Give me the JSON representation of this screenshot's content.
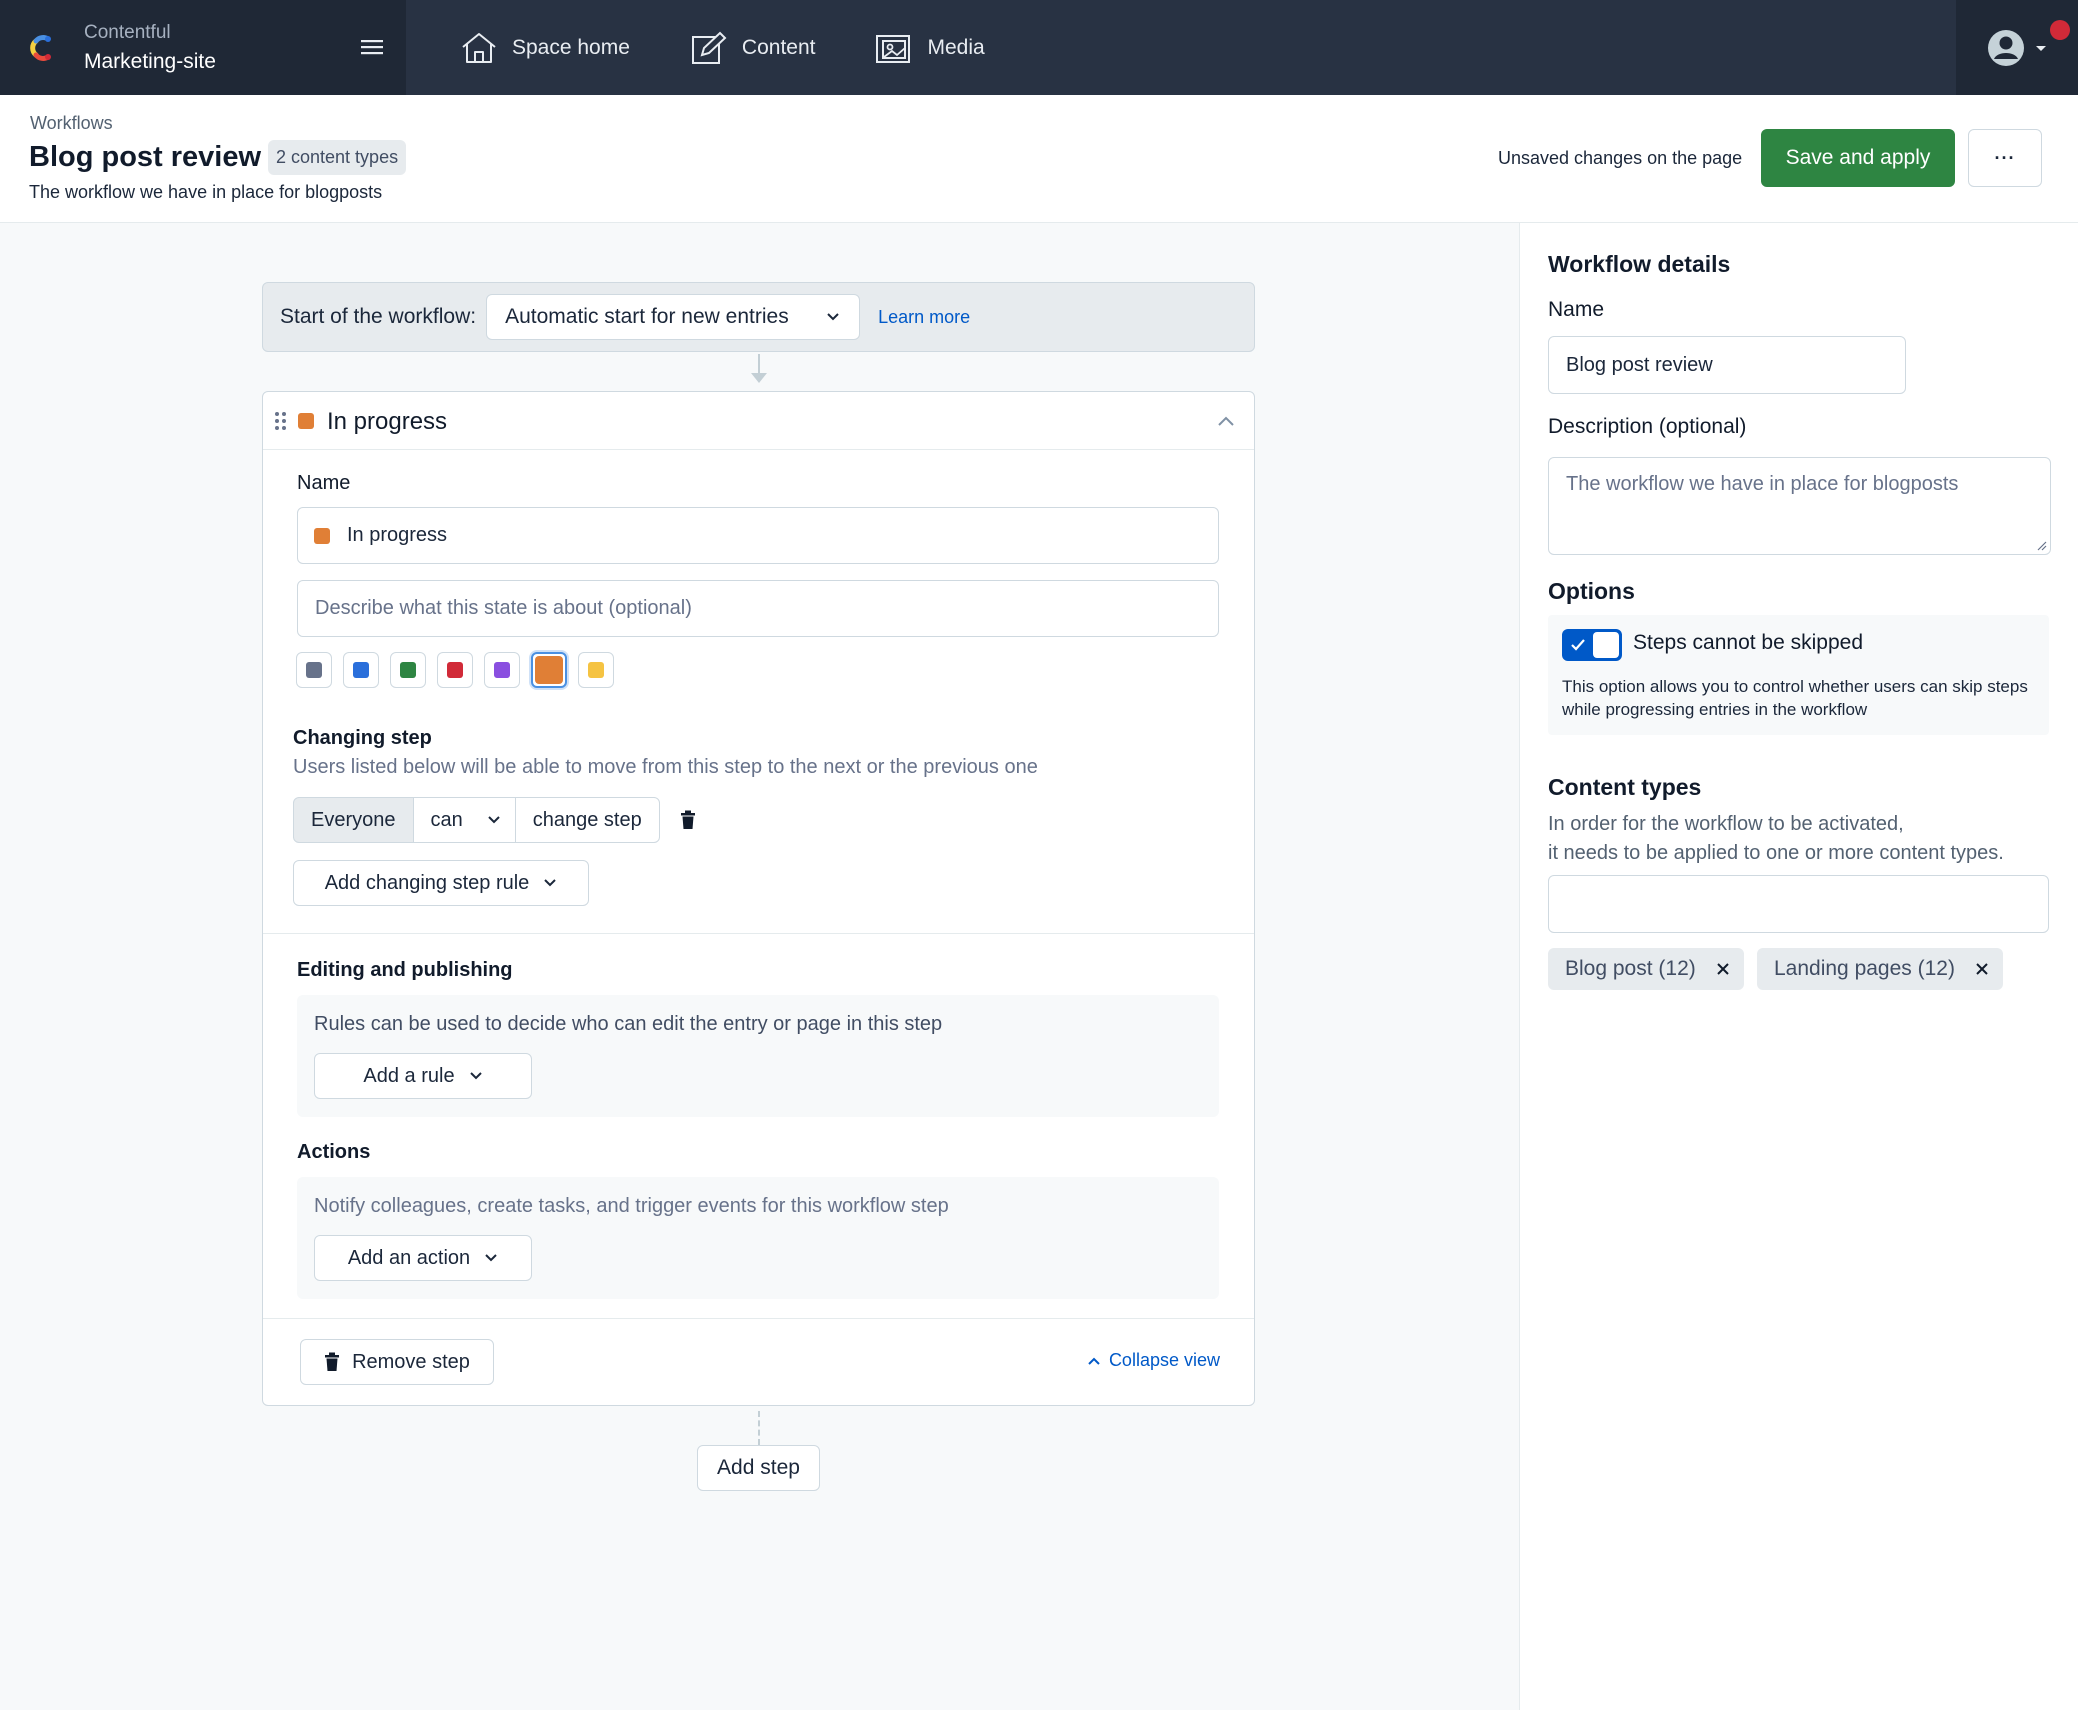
{
  "nav": {
    "org_label": "Contentful",
    "space_name": "Marketing-site",
    "items": [
      {
        "label": "Space home",
        "icon": "home-icon"
      },
      {
        "label": "Content",
        "icon": "content-edit-icon"
      },
      {
        "label": "Media",
        "icon": "media-icon"
      }
    ]
  },
  "header": {
    "breadcrumb": "Workflows",
    "title": "Blog post review",
    "badge": "2 content types",
    "subtitle": "The workflow we have in place for blogposts",
    "unsaved_text": "Unsaved changes on the page",
    "save_label": "Save and apply",
    "more_label": "···"
  },
  "workflow": {
    "start_label": "Start of the workflow:",
    "start_value": "Automatic start for new entries",
    "learn_more": "Learn more",
    "step": {
      "title": "In progress",
      "name_label": "Name",
      "name_value": "In progress",
      "description_placeholder": "Describe what this state is about (optional)",
      "colors": [
        "#67728a",
        "#2a6fdb",
        "#2e8542",
        "#d12a38",
        "#8a4fe0",
        "#e07f36",
        "#f5c342"
      ],
      "selected_color": "#e07f36",
      "changing_step": {
        "title": "Changing step",
        "helper": "Users listed below will be able to move from this step to the next or the previous one",
        "rule_who": "Everyone",
        "rule_permission": "can",
        "rule_action": "change step",
        "add_rule_label": "Add changing step rule"
      },
      "editing": {
        "title": "Editing and publishing",
        "helper": "Rules can be used to decide who can edit the entry or page in this step",
        "add_label": "Add a rule"
      },
      "actions": {
        "title": "Actions",
        "helper": "Notify colleagues, create tasks, and trigger events for this workflow step",
        "add_label": "Add an action"
      },
      "remove_label": "Remove step",
      "collapse_label": "Collapse view"
    },
    "add_step_label": "Add step"
  },
  "sidebar": {
    "title": "Workflow details",
    "name_label": "Name",
    "name_value": "Blog post review",
    "description_label": "Description (optional)",
    "description_value": "The workflow we have in place for blogposts",
    "options_title": "Options",
    "toggle_label": "Steps cannot be skipped",
    "toggle_on": true,
    "toggle_help": "This option allows you to control whether users can skip steps while progressing entries in the workflow",
    "content_types_title": "Content types",
    "content_types_help_1": "In order for the workflow to be activated,",
    "content_types_help_2": "it needs to be applied to one or more content types.",
    "content_types_input": "",
    "tags": [
      "Blog post (12)",
      "Landing pages (12)"
    ]
  }
}
